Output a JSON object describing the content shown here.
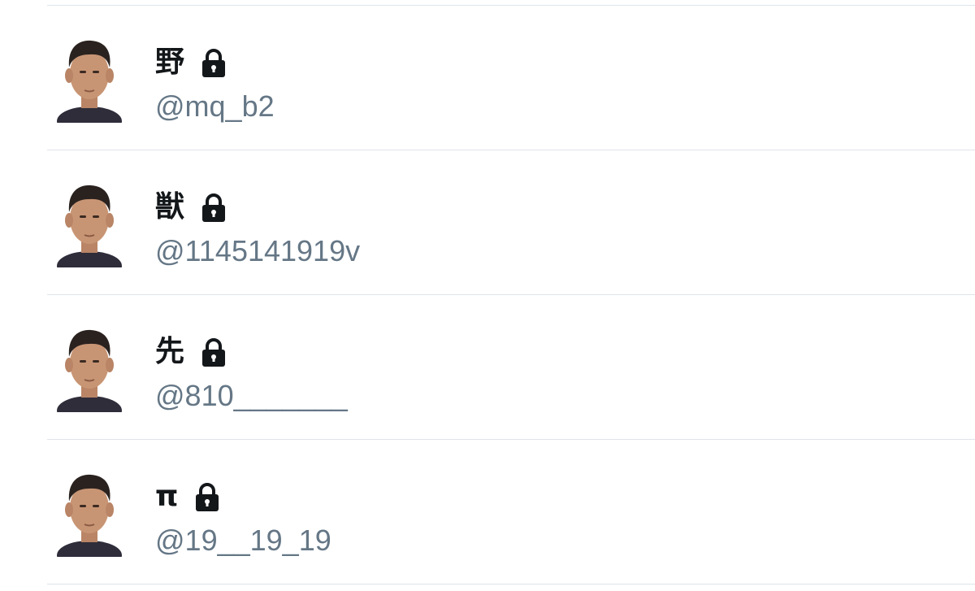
{
  "users": [
    {
      "name": "野",
      "handle": "@mq_b2",
      "protected": true,
      "avatar_icon": "avatar-photo",
      "lock_icon": "lock-icon"
    },
    {
      "name": "獣",
      "handle": "@1145141919v",
      "protected": true,
      "avatar_icon": "avatar-photo",
      "lock_icon": "lock-icon"
    },
    {
      "name": "先",
      "handle": "@810_______",
      "protected": true,
      "avatar_icon": "avatar-photo",
      "lock_icon": "lock-icon"
    },
    {
      "name": "π",
      "handle": "@19__19_19",
      "protected": true,
      "avatar_icon": "avatar-photo",
      "lock_icon": "lock-icon"
    }
  ],
  "colors": {
    "name_text": "#14171a",
    "handle_text": "#657786",
    "divider": "#dfe4ea",
    "background": "#ffffff"
  }
}
